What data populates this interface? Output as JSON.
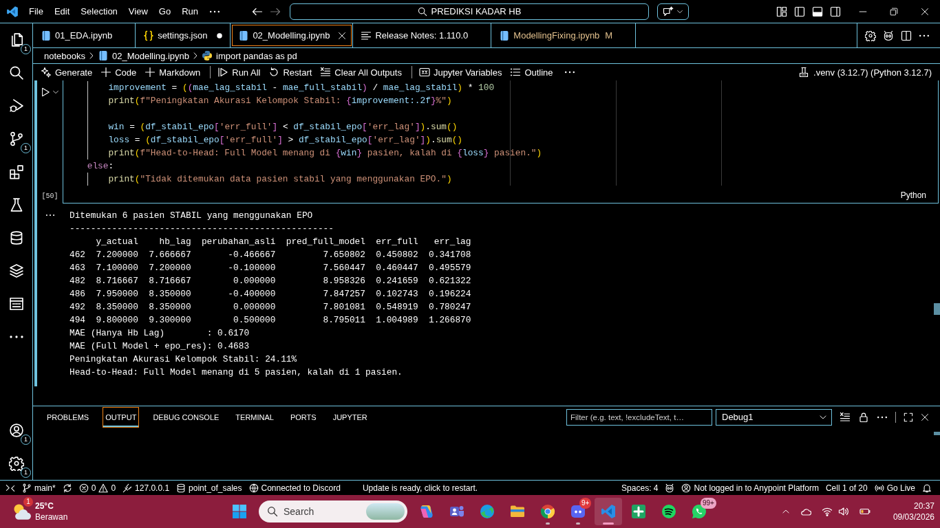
{
  "title_bar": {
    "menus": [
      "File",
      "Edit",
      "Selection",
      "View",
      "Go",
      "Run"
    ],
    "navigation": [
      {
        "kind": "back",
        "disabled": false
      },
      {
        "kind": "forward",
        "disabled": true
      }
    ],
    "command_center": "PREDIKSI KADAR HB"
  },
  "activity_bar": {
    "top": [
      {
        "kind": "files",
        "badge": "1"
      },
      {
        "kind": "search"
      },
      {
        "kind": "debug"
      },
      {
        "kind": "source-control",
        "badge": "1"
      },
      {
        "kind": "extensions"
      },
      {
        "kind": "testing"
      },
      {
        "kind": "database"
      },
      {
        "kind": "layers"
      },
      {
        "kind": "grid"
      },
      {
        "kind": "more"
      }
    ],
    "bottom": [
      {
        "kind": "account",
        "badge": "1"
      },
      {
        "kind": "settings",
        "badge": "1"
      }
    ]
  },
  "tabs": [
    {
      "label": "01_EDA.ipynb",
      "kind": "notebook",
      "selected": false,
      "dirty": false
    },
    {
      "label": "settings.json",
      "kind": "json",
      "selected": false,
      "dirty": true
    },
    {
      "label": "02_Modelling.ipynb",
      "kind": "notebook",
      "selected": true,
      "dirty": false
    },
    {
      "label": "Release Notes: 1.110.0",
      "kind": "notes",
      "selected": false,
      "dirty": false
    },
    {
      "label": "ModellingFixing.ipynb",
      "kind": "notebook",
      "selected": false,
      "dirty": false,
      "git_status": "M"
    }
  ],
  "breadcrumbs": [
    {
      "kind": "folder",
      "label": "notebooks"
    },
    {
      "kind": "notebook",
      "label": "02_Modelling.ipynb"
    },
    {
      "kind": "python",
      "label": "import pandas as pd"
    }
  ],
  "notebook_toolbar": {
    "groups": [
      [
        {
          "kind": "generate",
          "label": "Generate"
        },
        {
          "kind": "add",
          "label": "Code"
        },
        {
          "kind": "add",
          "label": "Markdown"
        }
      ],
      [
        {
          "kind": "run-all",
          "label": "Run All"
        },
        {
          "kind": "restart",
          "label": "Restart"
        },
        {
          "kind": "clear",
          "label": "Clear All Outputs"
        }
      ],
      [
        {
          "kind": "variables",
          "label": "Jupyter Variables"
        },
        {
          "kind": "outline",
          "label": "Outline"
        },
        {
          "kind": "more"
        }
      ]
    ],
    "kernel": ".venv (3.12.7) (Python 3.12.7)"
  },
  "code_cell": {
    "lines": [
      {
        "kind": "block",
        "children": [
          {
            "kind": "block",
            "children": [
              {
                "kind": "code",
                "tokens": [
                  {
                    "text": "improvement",
                    "kind": "var"
                  },
                  {
                    "text": " = ",
                    "kind": "op"
                  },
                  {
                    "text": "(",
                    "kind": "b1"
                  },
                  {
                    "text": "(",
                    "kind": "b2"
                  },
                  {
                    "text": "mae_lag_stabil",
                    "kind": "var"
                  },
                  {
                    "text": " - ",
                    "kind": "op"
                  },
                  {
                    "text": "mae_full_stabil",
                    "kind": "var"
                  },
                  {
                    "text": ")",
                    "kind": "b2"
                  },
                  {
                    "text": " / ",
                    "kind": "op"
                  },
                  {
                    "text": "mae_lag_stabil",
                    "kind": "var"
                  },
                  {
                    "text": ")",
                    "kind": "b1"
                  },
                  {
                    "text": " * ",
                    "kind": "op"
                  },
                  {
                    "text": "100",
                    "kind": "num"
                  }
                ]
              },
              {
                "kind": "code",
                "tokens": [
                  {
                    "text": "print",
                    "kind": "func"
                  },
                  {
                    "text": "(",
                    "kind": "b1"
                  },
                  {
                    "text": "f\"Peningkatan Akurasi Kelompok Stabil: ",
                    "kind": "str"
                  },
                  {
                    "text": "{",
                    "kind": "b2"
                  },
                  {
                    "text": "improvement",
                    "kind": "var"
                  },
                  {
                    "text": ":.2f",
                    "kind": "var"
                  },
                  {
                    "text": "}",
                    "kind": "b2"
                  },
                  {
                    "text": "%\"",
                    "kind": "str"
                  },
                  {
                    "text": ")",
                    "kind": "b1"
                  }
                ]
              },
              {
                "kind": "blank"
              },
              {
                "kind": "code",
                "tokens": [
                  {
                    "text": "win",
                    "kind": "var"
                  },
                  {
                    "text": " = ",
                    "kind": "op"
                  },
                  {
                    "text": "(",
                    "kind": "b1"
                  },
                  {
                    "text": "df_stabil_epo",
                    "kind": "var"
                  },
                  {
                    "text": "[",
                    "kind": "b2"
                  },
                  {
                    "text": "'err_full'",
                    "kind": "str"
                  },
                  {
                    "text": "]",
                    "kind": "b2"
                  },
                  {
                    "text": " < ",
                    "kind": "op"
                  },
                  {
                    "text": "df_stabil_epo",
                    "kind": "var"
                  },
                  {
                    "text": "[",
                    "kind": "b2"
                  },
                  {
                    "text": "'err_lag'",
                    "kind": "str"
                  },
                  {
                    "text": "]",
                    "kind": "b2"
                  },
                  {
                    "text": ")",
                    "kind": "b1"
                  },
                  {
                    "text": ".",
                    "kind": "op"
                  },
                  {
                    "text": "sum",
                    "kind": "func"
                  },
                  {
                    "text": "()",
                    "kind": "b1"
                  }
                ]
              },
              {
                "kind": "code",
                "tokens": [
                  {
                    "text": "loss",
                    "kind": "var"
                  },
                  {
                    "text": " = ",
                    "kind": "op"
                  },
                  {
                    "text": "(",
                    "kind": "b1"
                  },
                  {
                    "text": "df_stabil_epo",
                    "kind": "var"
                  },
                  {
                    "text": "[",
                    "kind": "b2"
                  },
                  {
                    "text": "'err_full'",
                    "kind": "str"
                  },
                  {
                    "text": "]",
                    "kind": "b2"
                  },
                  {
                    "text": " > ",
                    "kind": "op"
                  },
                  {
                    "text": "df_stabil_epo",
                    "kind": "var"
                  },
                  {
                    "text": "[",
                    "kind": "b2"
                  },
                  {
                    "text": "'err_lag'",
                    "kind": "str"
                  },
                  {
                    "text": "]",
                    "kind": "b2"
                  },
                  {
                    "text": ")",
                    "kind": "b1"
                  },
                  {
                    "text": ".",
                    "kind": "op"
                  },
                  {
                    "text": "sum",
                    "kind": "func"
                  },
                  {
                    "text": "()",
                    "kind": "b1"
                  }
                ]
              },
              {
                "kind": "code",
                "tokens": [
                  {
                    "text": "print",
                    "kind": "func"
                  },
                  {
                    "text": "(",
                    "kind": "b1"
                  },
                  {
                    "text": "f\"Head-to-Head: Full Model menang di ",
                    "kind": "str"
                  },
                  {
                    "text": "{",
                    "kind": "b2"
                  },
                  {
                    "text": "win",
                    "kind": "var"
                  },
                  {
                    "text": "}",
                    "kind": "b2"
                  },
                  {
                    "text": " pasien, kalah di ",
                    "kind": "str"
                  },
                  {
                    "text": "{",
                    "kind": "b2"
                  },
                  {
                    "text": "loss",
                    "kind": "var"
                  },
                  {
                    "text": "}",
                    "kind": "b2"
                  },
                  {
                    "text": " pasien.\"",
                    "kind": "str"
                  },
                  {
                    "text": ")",
                    "kind": "b1"
                  }
                ]
              }
            ]
          },
          {
            "kind": "code",
            "tokens": [
              {
                "text": "else",
                "kind": "kw"
              },
              {
                "text": ":",
                "kind": "op"
              }
            ],
            "children": [
              {
                "kind": "code",
                "tokens": [
                  {
                    "text": "print",
                    "kind": "func"
                  },
                  {
                    "text": "(",
                    "kind": "b1"
                  },
                  {
                    "text": "\"Tidak ditemukan data pasien stabil yang menggunakan EPO.\"",
                    "kind": "str"
                  },
                  {
                    "text": ")",
                    "kind": "b1"
                  }
                ]
              }
            ]
          }
        ]
      }
    ],
    "execution_count": "[50]",
    "language": "Python"
  },
  "output": {
    "lines": [
      "Ditemukan 6 pasien STABIL yang menggunakan EPO",
      "--------------------------------------------------"
    ],
    "table": {
      "columns": [
        "y_actual",
        "hb_lag",
        "perubahan_asli",
        "pred_full_model",
        "err_full",
        "err_lag"
      ],
      "rows": [
        {
          "index": "462",
          "cells": [
            "7.200000",
            "7.666667",
            "-0.466667",
            "7.650802",
            "0.450802",
            "0.341708"
          ]
        },
        {
          "index": "463",
          "cells": [
            "7.100000",
            "7.200000",
            "-0.100000",
            "7.560447",
            "0.460447",
            "0.495579"
          ]
        },
        {
          "index": "482",
          "cells": [
            "8.716667",
            "8.716667",
            "0.000000",
            "8.958326",
            "0.241659",
            "0.621322"
          ]
        },
        {
          "index": "486",
          "cells": [
            "7.950000",
            "8.350000",
            "-0.400000",
            "7.847257",
            "0.102743",
            "0.196224"
          ]
        },
        {
          "index": "492",
          "cells": [
            "8.350000",
            "8.350000",
            "0.000000",
            "7.801081",
            "0.548919",
            "0.780247"
          ]
        },
        {
          "index": "494",
          "cells": [
            "9.800000",
            "9.300000",
            "0.500000",
            "8.795011",
            "1.004989",
            "1.266870"
          ]
        }
      ]
    },
    "summary": [
      "MAE (Hanya Hb Lag)        : 0.6170",
      "MAE (Full Model + epo_res): 0.4683",
      "Peningkatan Akurasi Kelompok Stabil: 24.11%",
      "Head-to-Head: Full Model menang di 5 pasien, kalah di 1 pasien."
    ]
  },
  "panel": {
    "tabs": [
      {
        "label": "PROBLEMS",
        "selected": false
      },
      {
        "label": "OUTPUT",
        "selected": true
      },
      {
        "label": "DEBUG CONSOLE",
        "selected": false
      },
      {
        "label": "TERMINAL",
        "selected": false
      },
      {
        "label": "PORTS",
        "selected": false
      },
      {
        "label": "JUPYTER",
        "selected": false
      }
    ],
    "filter": {
      "placeholder": "Filter (e.g. text, !excludeText, t…"
    },
    "channel": "Debug1"
  },
  "status_bar": {
    "left": [
      {
        "kind": "remote"
      },
      {
        "kind": "branch",
        "label": "main*"
      },
      {
        "kind": "sync"
      },
      {
        "kind": "problems",
        "errors": "0",
        "warnings": "0"
      },
      {
        "kind": "port",
        "label": "127.0.0.1"
      },
      {
        "kind": "database",
        "label": "point_of_sales"
      },
      {
        "kind": "globe",
        "label": "Connected to Discord"
      }
    ],
    "notification": "Update is ready, click to restart.",
    "right": [
      {
        "kind": "text",
        "label": "Spaces: 4"
      },
      {
        "kind": "copilot"
      },
      {
        "kind": "account",
        "label": "Not logged in to Anypoint Platform"
      },
      {
        "kind": "text",
        "label": "Cell 1 of 20"
      },
      {
        "kind": "broadcast",
        "label": "Go Live"
      },
      {
        "kind": "bell"
      }
    ]
  },
  "taskbar": {
    "weather": {
      "temperature": "25°C",
      "condition": "Berawan",
      "badge": "1"
    },
    "search": {
      "placeholder": "Search"
    },
    "apps": [
      {
        "kind": "copilot",
        "running": false,
        "selected": false
      },
      {
        "kind": "teams",
        "running": false,
        "selected": false
      },
      {
        "kind": "edge",
        "running": false,
        "selected": false
      },
      {
        "kind": "explorer",
        "running": false,
        "selected": false
      },
      {
        "kind": "chrome",
        "running": true,
        "selected": false
      },
      {
        "kind": "discord",
        "running": true,
        "selected": false,
        "badge": "9+"
      },
      {
        "kind": "vscode",
        "running": true,
        "selected": true
      },
      {
        "kind": "sheets",
        "running": false,
        "selected": false
      },
      {
        "kind": "spotify",
        "running": false,
        "selected": false
      },
      {
        "kind": "whatsapp",
        "running": false,
        "selected": false,
        "badge": "99+"
      }
    ],
    "clock": {
      "time": "20:37",
      "date": "09/03/2026"
    }
  }
}
